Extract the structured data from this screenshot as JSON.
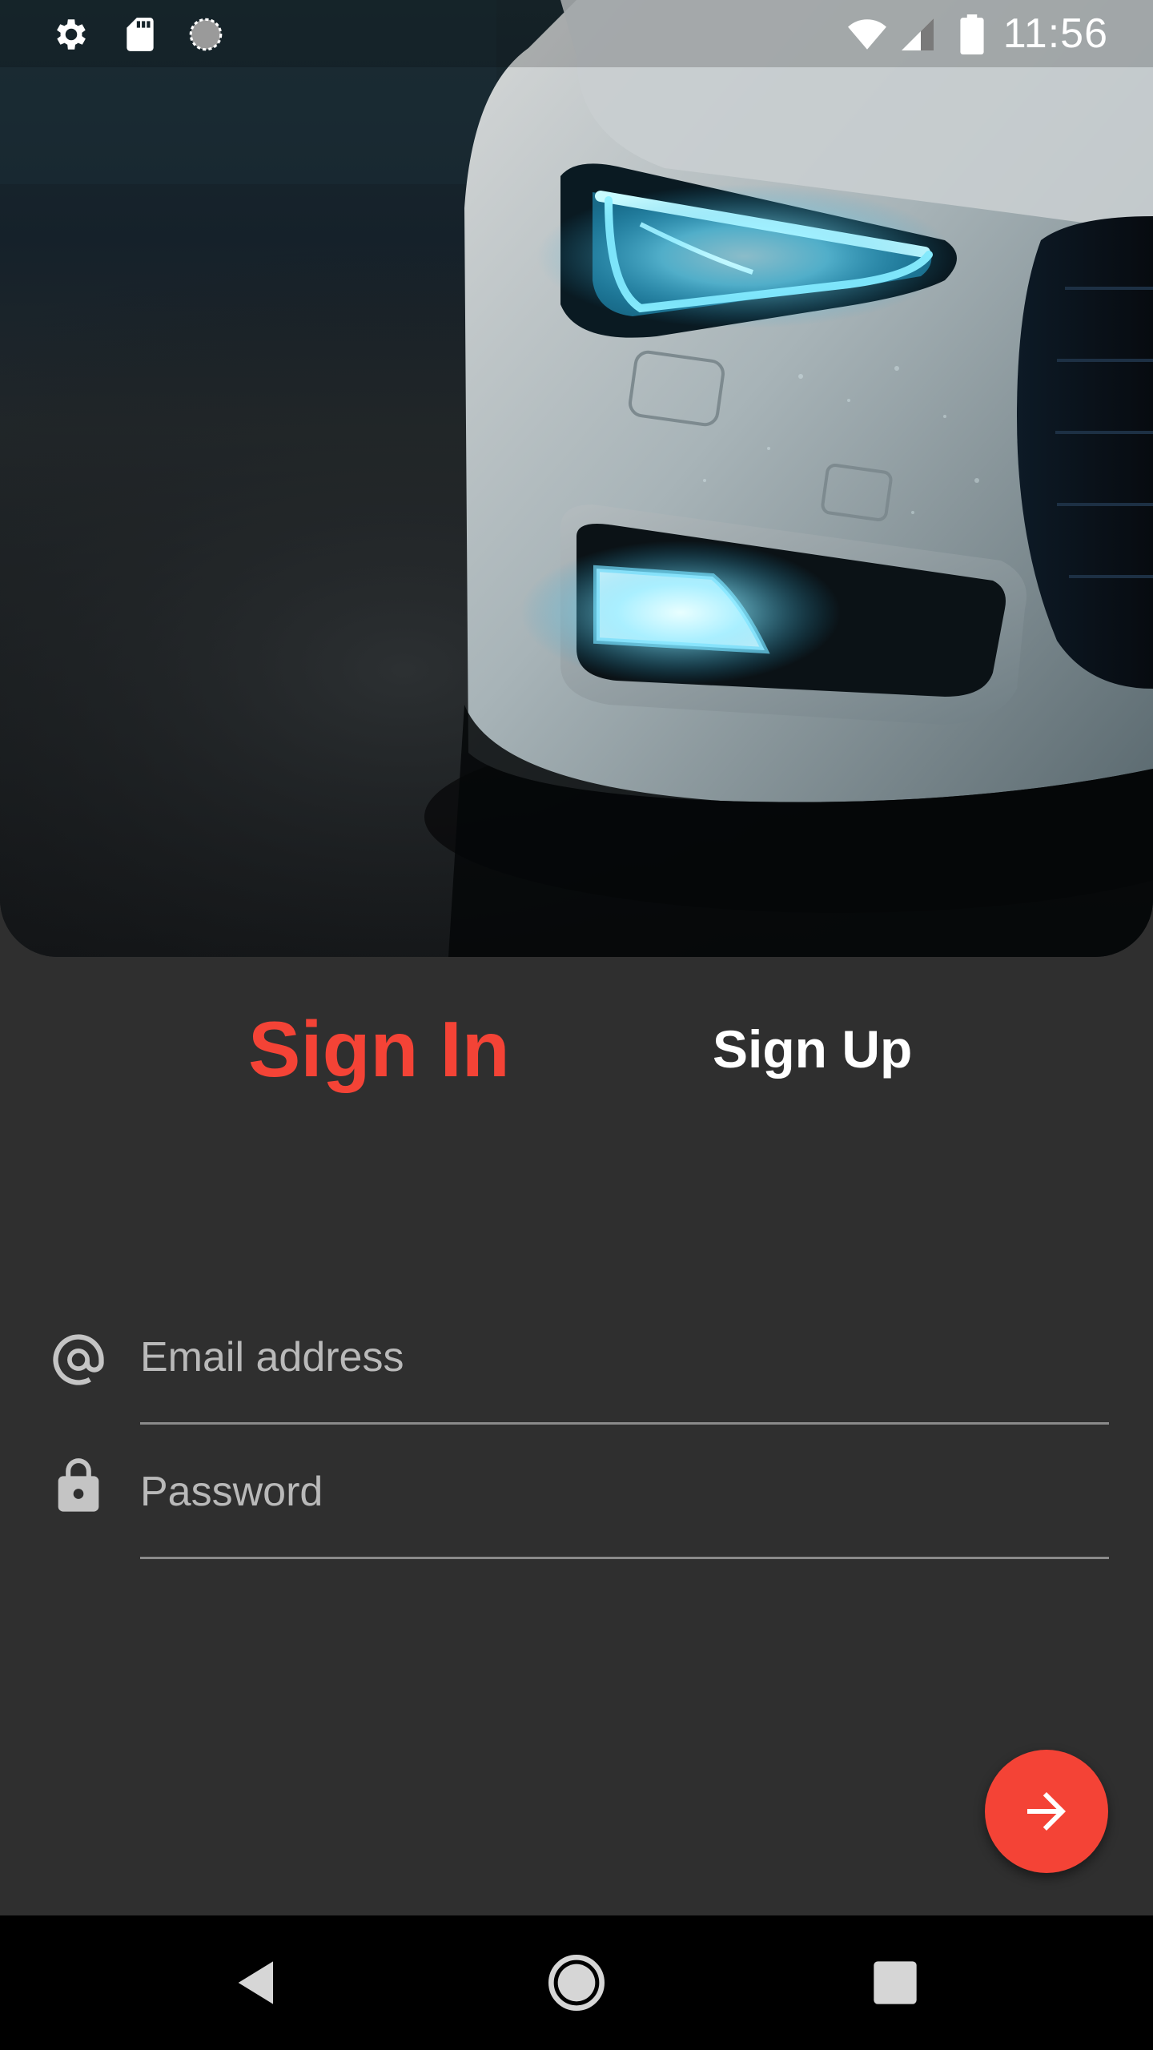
{
  "status_bar": {
    "time": "11:56",
    "icons": [
      "settings-icon",
      "sd-card-icon",
      "sync-icon",
      "wifi-icon",
      "signal-icon",
      "battery-icon"
    ]
  },
  "hero": {
    "image": "car-headlight-photo"
  },
  "tabs": {
    "sign_in": "Sign In",
    "sign_up": "Sign Up"
  },
  "form": {
    "email": {
      "placeholder": "Email address",
      "value": "",
      "icon": "at-sign-icon"
    },
    "password": {
      "placeholder": "Password",
      "value": "",
      "icon": "lock-icon"
    }
  },
  "fab": {
    "icon": "arrow-right-icon"
  },
  "nav_bar": {
    "buttons": [
      "back-icon",
      "home-icon",
      "recents-icon"
    ]
  },
  "colors": {
    "accent": "#f44336",
    "background": "#2f2f2f",
    "text_primary": "#ffffff",
    "text_hint": "#b9b9b9",
    "divider": "#8a8a8a"
  }
}
